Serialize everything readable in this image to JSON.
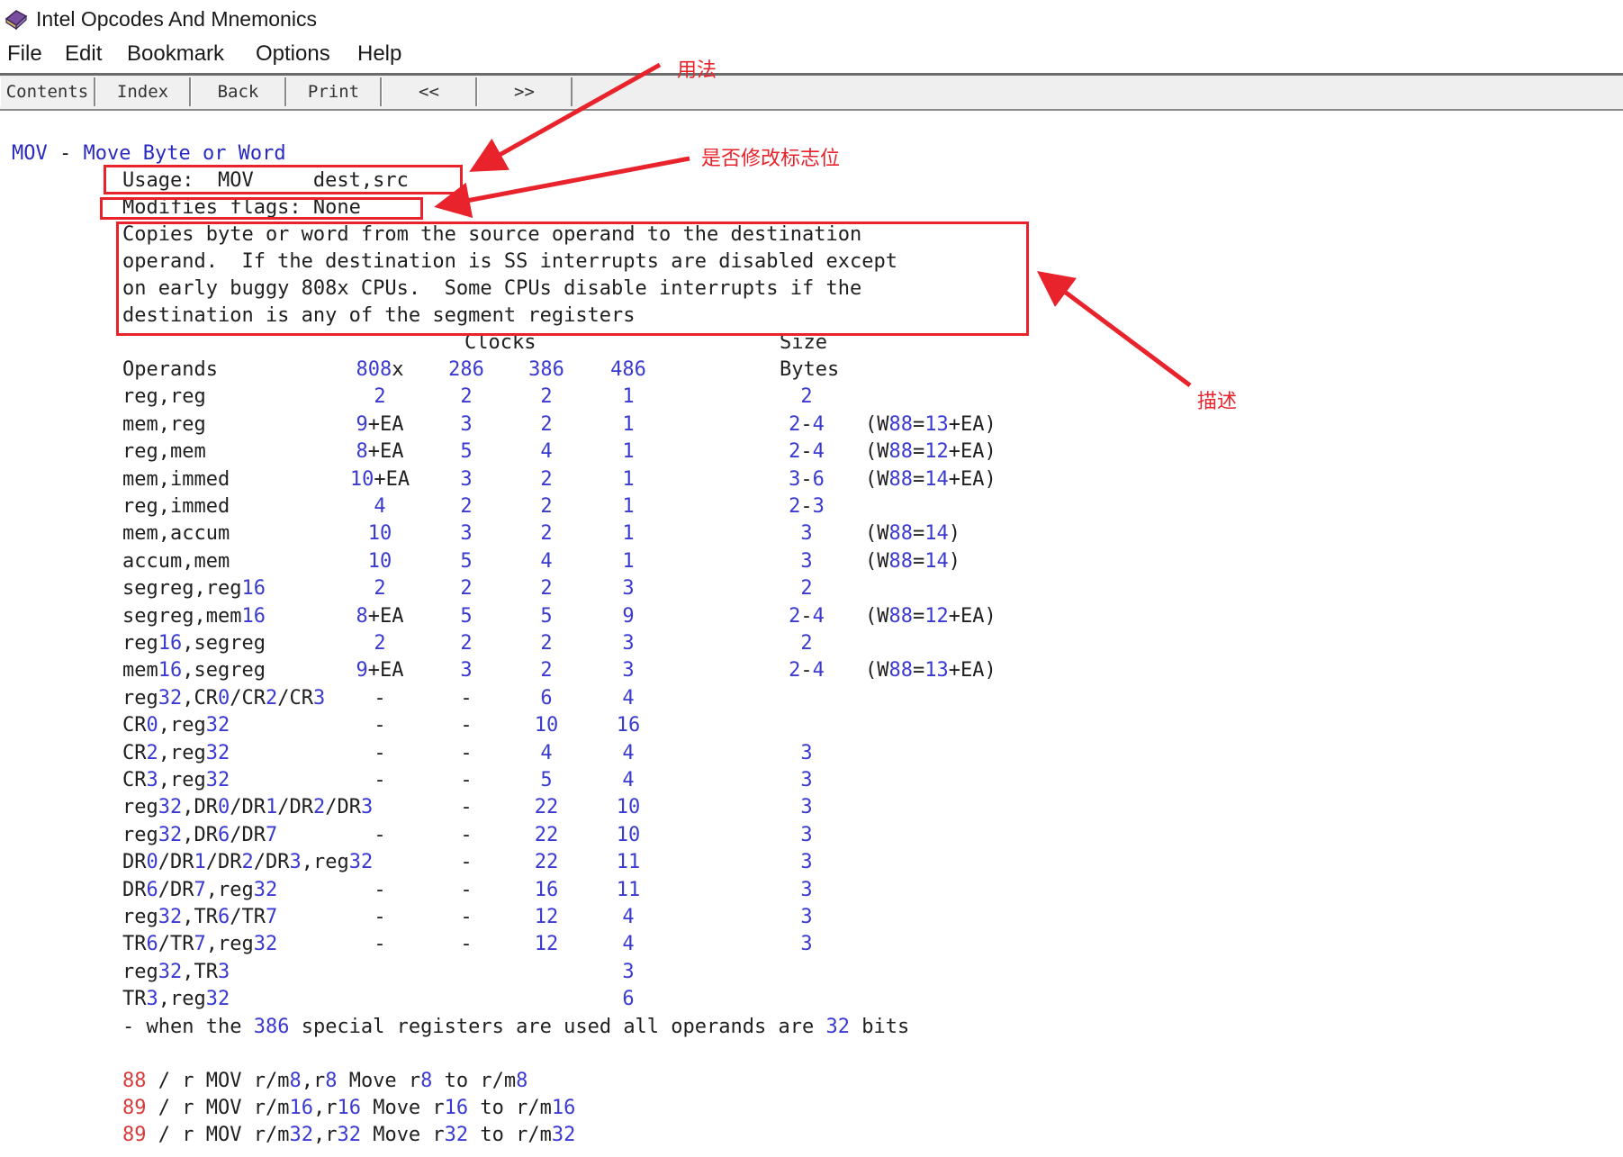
{
  "window": {
    "title": "Intel Opcodes And Mnemonics"
  },
  "menu": [
    "File",
    "Edit",
    "Bookmark",
    "Options",
    "Help"
  ],
  "toolbar": [
    "Contents",
    "Index",
    "Back",
    "Print",
    "<<",
    ">>"
  ],
  "entry": {
    "mnemonic": "MOV",
    "dash": "-",
    "name": "Move Byte or Word",
    "usage": "Usage:  MOV     dest,src",
    "flags": "Modifies flags: None",
    "description": [
      "Copies byte or word from the source operand to the destination",
      "operand.  If the destination is SS interrupts are disabled except",
      "on early buggy 808x CPUs.  Some CPUs disable interrupts if the",
      "destination is any of the segment registers"
    ]
  },
  "table": {
    "clocks_header": "Clocks",
    "size_header": "Size",
    "operands_header": "Operands",
    "bytes_header": "Bytes",
    "cpu_headers": [
      "808x",
      "286",
      "386",
      "486"
    ],
    "rows": [
      [
        "reg,reg",
        "2",
        "2",
        "2",
        "1",
        "2",
        ""
      ],
      [
        "mem,reg",
        "9+EA",
        "3",
        "2",
        "1",
        "2-4",
        "(W88=13+EA)"
      ],
      [
        "reg,mem",
        "8+EA",
        "5",
        "4",
        "1",
        "2-4",
        "(W88=12+EA)"
      ],
      [
        "mem,immed",
        "10+EA",
        "3",
        "2",
        "1",
        "3-6",
        "(W88=14+EA)"
      ],
      [
        "reg,immed",
        "4",
        "2",
        "2",
        "1",
        "2-3",
        ""
      ],
      [
        "mem,accum",
        "10",
        "3",
        "2",
        "1",
        "3",
        "(W88=14)"
      ],
      [
        "accum,mem",
        "10",
        "5",
        "4",
        "1",
        "3",
        "(W88=14)"
      ],
      [
        "segreg,reg16",
        "2",
        "2",
        "2",
        "3",
        "2",
        ""
      ],
      [
        "segreg,mem16",
        "8+EA",
        "5",
        "5",
        "9",
        "2-4",
        "(W88=12+EA)"
      ],
      [
        "reg16,segreg",
        "2",
        "2",
        "2",
        "3",
        "2",
        ""
      ],
      [
        "mem16,segreg",
        "9+EA",
        "3",
        "2",
        "3",
        "2-4",
        "(W88=13+EA)"
      ],
      [
        "reg32,CR0/CR2/CR3",
        "-",
        "-",
        "6",
        "4",
        "",
        ""
      ],
      [
        "CR0,reg32",
        "-",
        "-",
        "10",
        "16",
        "",
        ""
      ],
      [
        "CR2,reg32",
        "-",
        "-",
        "4",
        "4",
        "3",
        ""
      ],
      [
        "CR3,reg32",
        "-",
        "-",
        "5",
        "4",
        "3",
        ""
      ],
      [
        "reg32,DR0/DR1/DR2/DR3",
        "",
        "-",
        "22",
        "10",
        "3",
        ""
      ],
      [
        "reg32,DR6/DR7",
        "-",
        "-",
        "22",
        "10",
        "3",
        ""
      ],
      [
        "DR0/DR1/DR2/DR3,reg32",
        "",
        "-",
        "22",
        "11",
        "3",
        ""
      ],
      [
        "DR6/DR7,reg32",
        "-",
        "-",
        "16",
        "11",
        "3",
        ""
      ],
      [
        "reg32,TR6/TR7",
        "-",
        "-",
        "12",
        "4",
        "3",
        ""
      ],
      [
        "TR6/TR7,reg32",
        "-",
        "-",
        "12",
        "4",
        "3",
        ""
      ],
      [
        "reg32,TR3",
        "",
        "",
        "",
        "3",
        "",
        ""
      ],
      [
        "TR3,reg32",
        "",
        "",
        "",
        "6",
        "",
        ""
      ]
    ],
    "footnote": "- when the 386 special registers are used all operands are 32 bits"
  },
  "encodings": [
    {
      "opcode": "88",
      "text": " / r MOV r/m8,r8 Move r8 to r/m8"
    },
    {
      "opcode": "89",
      "text": " / r MOV r/m16,r16 Move r16 to r/m16"
    },
    {
      "opcode": "89",
      "text": " / r MOV r/m32,r32 Move r32 to r/m32"
    }
  ],
  "annotations": {
    "usage": "用法",
    "flags": "是否修改标志位",
    "description": "描述"
  },
  "colors": {
    "highlight": "#e8232c",
    "digits": "#3a3ad0",
    "opcode": "#d83b3b"
  }
}
